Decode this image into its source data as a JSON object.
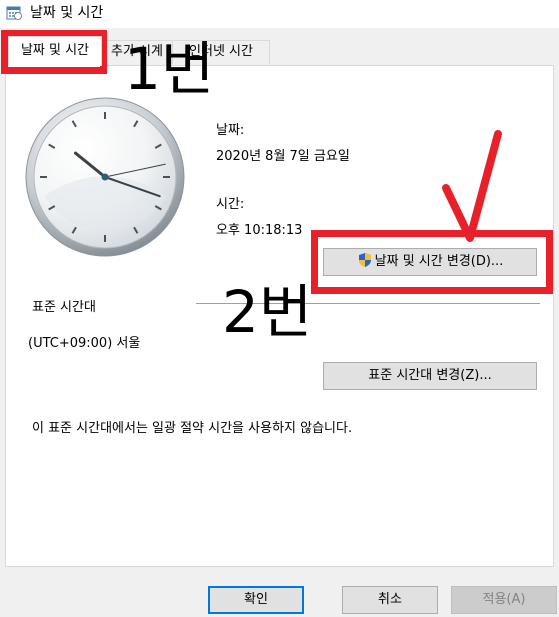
{
  "window": {
    "title": "날짜 및 시간",
    "icon": "date-time-calendar-icon"
  },
  "tabs": [
    {
      "label": "날짜 및 시간",
      "active": true
    },
    {
      "label": "추가 시계",
      "active": false
    },
    {
      "label": "인터넷 시간",
      "active": false
    }
  ],
  "date_section": {
    "date_label": "날짜:",
    "date_value": "2020년 8월 7일 금요일",
    "time_label": "시간:",
    "time_value": "오후 10:18:13"
  },
  "clock": {
    "hour": 10,
    "minute": 18,
    "second": 13
  },
  "change_datetime_button": {
    "label": "날짜 및 시간 변경(D)...",
    "icon": "uac-shield-icon"
  },
  "timezone_section": {
    "heading": "표준 시간대",
    "value": "(UTC+09:00) 서울",
    "change_button": "표준 시간대 변경(Z)...",
    "dst_note": "이 표준 시간대에서는 일광 절약 시간을 사용하지 않습니다."
  },
  "footer": {
    "ok": "확인",
    "cancel": "취소",
    "apply": "적용(A)"
  },
  "annotations": {
    "label_1": "1번",
    "label_2": "2번",
    "color": "#e8202a"
  }
}
